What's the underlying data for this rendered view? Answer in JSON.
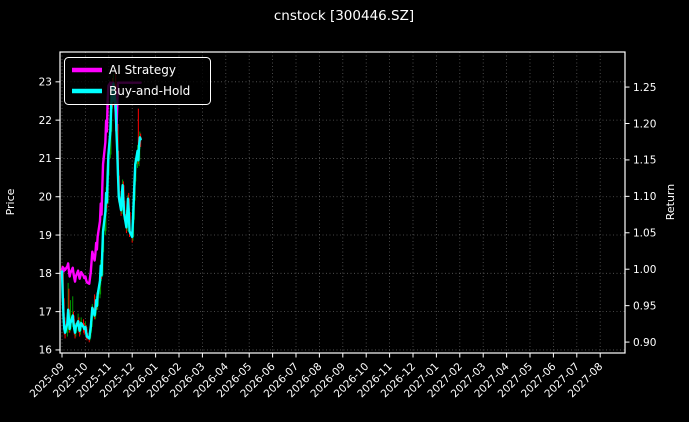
{
  "title": "cnstock [300446.SZ]",
  "colors": {
    "background": "#000000",
    "foreground": "#ffffff",
    "grid": "#c8c8c8",
    "ai_strategy": "#ff00ff",
    "buy_and_hold": "#00ffff",
    "candle_up": "#009900",
    "candle_down": "#ff0000"
  },
  "legend": [
    {
      "label": "AI Strategy",
      "color": "#ff00ff"
    },
    {
      "label": "Buy-and-Hold",
      "color": "#00ffff"
    }
  ],
  "axes": {
    "left": {
      "label": "Price",
      "ticks": [
        16,
        17,
        18,
        19,
        20,
        21,
        22,
        23
      ],
      "range": [
        15.92,
        23.78
      ]
    },
    "right": {
      "label": "Return",
      "ticks": [
        "0.90",
        "0.95",
        "1.00",
        "1.05",
        "1.10",
        "1.15",
        "1.20",
        "1.25"
      ],
      "range": [
        0.885,
        1.298
      ]
    },
    "x": {
      "labels": [
        "2025-09",
        "2025-10",
        "2025-11",
        "2025-12",
        "2026-01",
        "2026-02",
        "2026-03",
        "2026-04",
        "2026-05",
        "2026-06",
        "2026-07",
        "2026-08",
        "2026-09",
        "2026-10",
        "2026-11",
        "2026-12",
        "2027-01",
        "2027-02",
        "2027-03",
        "2027-04",
        "2027-05",
        "2027-06",
        "2027-07",
        "2027-08"
      ]
    }
  },
  "chart_data": {
    "type": "line",
    "title": "cnstock [300446.SZ]",
    "xlabel": "",
    "ylabel_left": "Price",
    "ylabel_right": "Return",
    "x_range_months": [
      "2025-09",
      "2027-09"
    ],
    "grid": true,
    "legend_position": "upper-left",
    "dates": [
      "2025-09-01",
      "2025-09-02",
      "2025-09-03",
      "2025-09-04",
      "2025-09-05",
      "2025-09-08",
      "2025-09-09",
      "2025-09-10",
      "2025-09-11",
      "2025-09-12",
      "2025-09-15",
      "2025-09-16",
      "2025-09-17",
      "2025-09-18",
      "2025-09-19",
      "2025-09-22",
      "2025-09-23",
      "2025-09-24",
      "2025-09-25",
      "2025-09-26",
      "2025-09-29",
      "2025-09-30",
      "2025-10-01",
      "2025-10-02",
      "2025-10-03",
      "2025-10-06",
      "2025-10-07",
      "2025-10-08",
      "2025-10-09",
      "2025-10-10",
      "2025-10-13",
      "2025-10-14",
      "2025-10-15",
      "2025-10-16",
      "2025-10-17",
      "2025-10-20",
      "2025-10-21",
      "2025-10-22",
      "2025-10-23",
      "2025-10-24",
      "2025-10-27",
      "2025-10-28",
      "2025-10-29",
      "2025-10-30",
      "2025-10-31",
      "2025-11-03",
      "2025-11-04",
      "2025-11-05",
      "2025-11-06",
      "2025-11-07",
      "2025-11-10",
      "2025-11-11",
      "2025-11-12",
      "2025-11-13",
      "2025-11-14",
      "2025-11-17",
      "2025-11-18",
      "2025-11-19",
      "2025-11-20",
      "2025-11-21",
      "2025-11-24",
      "2025-11-25",
      "2025-11-26",
      "2025-11-27",
      "2025-11-28",
      "2025-12-01",
      "2025-12-02",
      "2025-12-03",
      "2025-12-04",
      "2025-12-05",
      "2025-12-08",
      "2025-12-09",
      "2025-12-10",
      "2025-12-11",
      "2025-12-12"
    ],
    "ohlc": [
      [
        18.1,
        18.2,
        17.9,
        18.05
      ],
      [
        18.0,
        18.05,
        17.3,
        17.4
      ],
      [
        17.35,
        17.45,
        16.75,
        16.85
      ],
      [
        16.85,
        16.95,
        16.4,
        16.55
      ],
      [
        16.55,
        16.75,
        16.3,
        16.45
      ],
      [
        16.45,
        16.8,
        16.35,
        16.7
      ],
      [
        16.7,
        17.75,
        16.65,
        17.05
      ],
      [
        17.05,
        17.6,
        16.7,
        16.8
      ],
      [
        16.8,
        16.9,
        16.45,
        16.55
      ],
      [
        16.55,
        17.3,
        16.5,
        16.7
      ],
      [
        16.7,
        17.4,
        16.6,
        16.9
      ],
      [
        16.9,
        17.0,
        16.55,
        16.7
      ],
      [
        16.7,
        16.8,
        16.4,
        16.55
      ],
      [
        16.55,
        16.65,
        16.3,
        16.45
      ],
      [
        16.45,
        16.7,
        16.35,
        16.6
      ],
      [
        16.6,
        16.95,
        16.5,
        16.75
      ],
      [
        16.75,
        16.85,
        16.45,
        16.6
      ],
      [
        16.6,
        16.7,
        16.35,
        16.5
      ],
      [
        16.5,
        16.75,
        16.4,
        16.6
      ],
      [
        16.6,
        16.85,
        16.5,
        16.7
      ],
      [
        16.7,
        16.8,
        16.45,
        16.6
      ],
      [
        16.6,
        16.7,
        16.4,
        16.55
      ],
      [
        16.55,
        16.75,
        16.45,
        16.6
      ],
      [
        16.6,
        16.65,
        16.3,
        16.45
      ],
      [
        16.45,
        16.55,
        16.25,
        16.35
      ],
      [
        16.35,
        16.45,
        16.2,
        16.3
      ],
      [
        16.3,
        16.55,
        16.25,
        16.45
      ],
      [
        16.45,
        16.7,
        16.35,
        16.6
      ],
      [
        16.6,
        16.95,
        16.5,
        16.85
      ],
      [
        16.85,
        17.2,
        16.75,
        17.1
      ],
      [
        17.1,
        17.45,
        16.8,
        16.9
      ],
      [
        16.9,
        17.15,
        16.8,
        17.05
      ],
      [
        17.05,
        17.4,
        16.95,
        17.3
      ],
      [
        17.3,
        17.5,
        17.05,
        17.15
      ],
      [
        17.15,
        17.55,
        17.05,
        17.45
      ],
      [
        17.45,
        17.9,
        17.35,
        17.8
      ],
      [
        17.8,
        18.35,
        17.7,
        18.2
      ],
      [
        18.2,
        18.4,
        17.85,
        17.95
      ],
      [
        17.95,
        18.65,
        17.9,
        18.55
      ],
      [
        18.55,
        19.2,
        18.45,
        19.1
      ],
      [
        19.1,
        19.75,
        19.0,
        19.6
      ],
      [
        19.6,
        20.25,
        19.5,
        20.1
      ],
      [
        20.1,
        20.3,
        19.7,
        19.85
      ],
      [
        19.85,
        20.7,
        19.8,
        20.55
      ],
      [
        20.55,
        21.25,
        20.45,
        21.1
      ],
      [
        21.1,
        21.85,
        21.0,
        21.7
      ],
      [
        21.7,
        22.45,
        21.6,
        22.3
      ],
      [
        22.3,
        23.0,
        22.2,
        22.85
      ],
      [
        22.85,
        23.1,
        22.35,
        22.5
      ],
      [
        22.5,
        23.2,
        22.4,
        22.95
      ],
      [
        22.95,
        23.3,
        22.25,
        22.4
      ],
      [
        22.4,
        22.55,
        21.55,
        21.7
      ],
      [
        21.7,
        21.85,
        21.05,
        21.2
      ],
      [
        21.2,
        21.9,
        20.4,
        20.55
      ],
      [
        20.55,
        20.7,
        19.85,
        20.0
      ],
      [
        20.0,
        20.15,
        19.5,
        19.65
      ],
      [
        19.65,
        20.2,
        19.55,
        20.05
      ],
      [
        20.05,
        20.45,
        19.95,
        20.3
      ],
      [
        20.3,
        20.4,
        19.75,
        19.9
      ],
      [
        19.9,
        20.0,
        19.4,
        19.55
      ],
      [
        19.55,
        19.65,
        19.05,
        19.2
      ],
      [
        19.2,
        19.7,
        19.1,
        19.55
      ],
      [
        19.55,
        20.05,
        19.45,
        19.95
      ],
      [
        19.95,
        20.1,
        19.5,
        19.6
      ],
      [
        19.6,
        19.7,
        18.95,
        19.1
      ],
      [
        19.1,
        19.25,
        18.8,
        18.95
      ],
      [
        18.95,
        19.5,
        18.85,
        19.4
      ],
      [
        19.4,
        20.0,
        19.3,
        19.9
      ],
      [
        19.9,
        20.55,
        19.8,
        20.4
      ],
      [
        20.4,
        21.0,
        20.3,
        20.85
      ],
      [
        20.85,
        21.35,
        20.75,
        21.2
      ],
      [
        21.2,
        22.3,
        20.85,
        20.95
      ],
      [
        20.95,
        21.5,
        20.8,
        21.35
      ],
      [
        21.35,
        21.7,
        21.25,
        21.55
      ],
      [
        21.55,
        21.65,
        21.3,
        21.5
      ]
    ],
    "series": [
      {
        "name": "AI Strategy",
        "axis": "right",
        "color": "#ff00ff",
        "values": [
          1.0,
          1.003,
          0.997,
          1.001,
          0.999,
          1.004,
          1.008,
          0.998,
          0.99,
          0.995,
          1.002,
          0.994,
          0.988,
          0.983,
          0.99,
          0.998,
          0.992,
          0.987,
          0.991,
          0.996,
          0.991,
          0.988,
          0.99,
          0.985,
          0.982,
          0.98,
          0.988,
          0.996,
          1.01,
          1.024,
          1.012,
          1.021,
          1.036,
          1.027,
          1.045,
          1.066,
          1.09,
          1.075,
          1.111,
          1.144,
          1.174,
          1.204,
          1.189,
          1.231,
          1.252,
          1.256,
          1.248,
          1.256,
          1.235,
          1.256,
          1.215,
          1.19,
          1.225,
          1.256,
          1.256,
          1.256,
          1.256,
          1.256,
          1.256,
          1.256,
          1.256,
          1.256,
          1.256,
          1.256,
          1.256,
          1.256,
          1.256,
          1.256,
          1.256,
          1.256,
          1.256,
          1.256,
          1.256,
          1.256,
          1.256
        ]
      },
      {
        "name": "Buy-and-Hold",
        "axis": "left",
        "color": "#00ffff",
        "values_from": "ohlc_close"
      }
    ]
  }
}
